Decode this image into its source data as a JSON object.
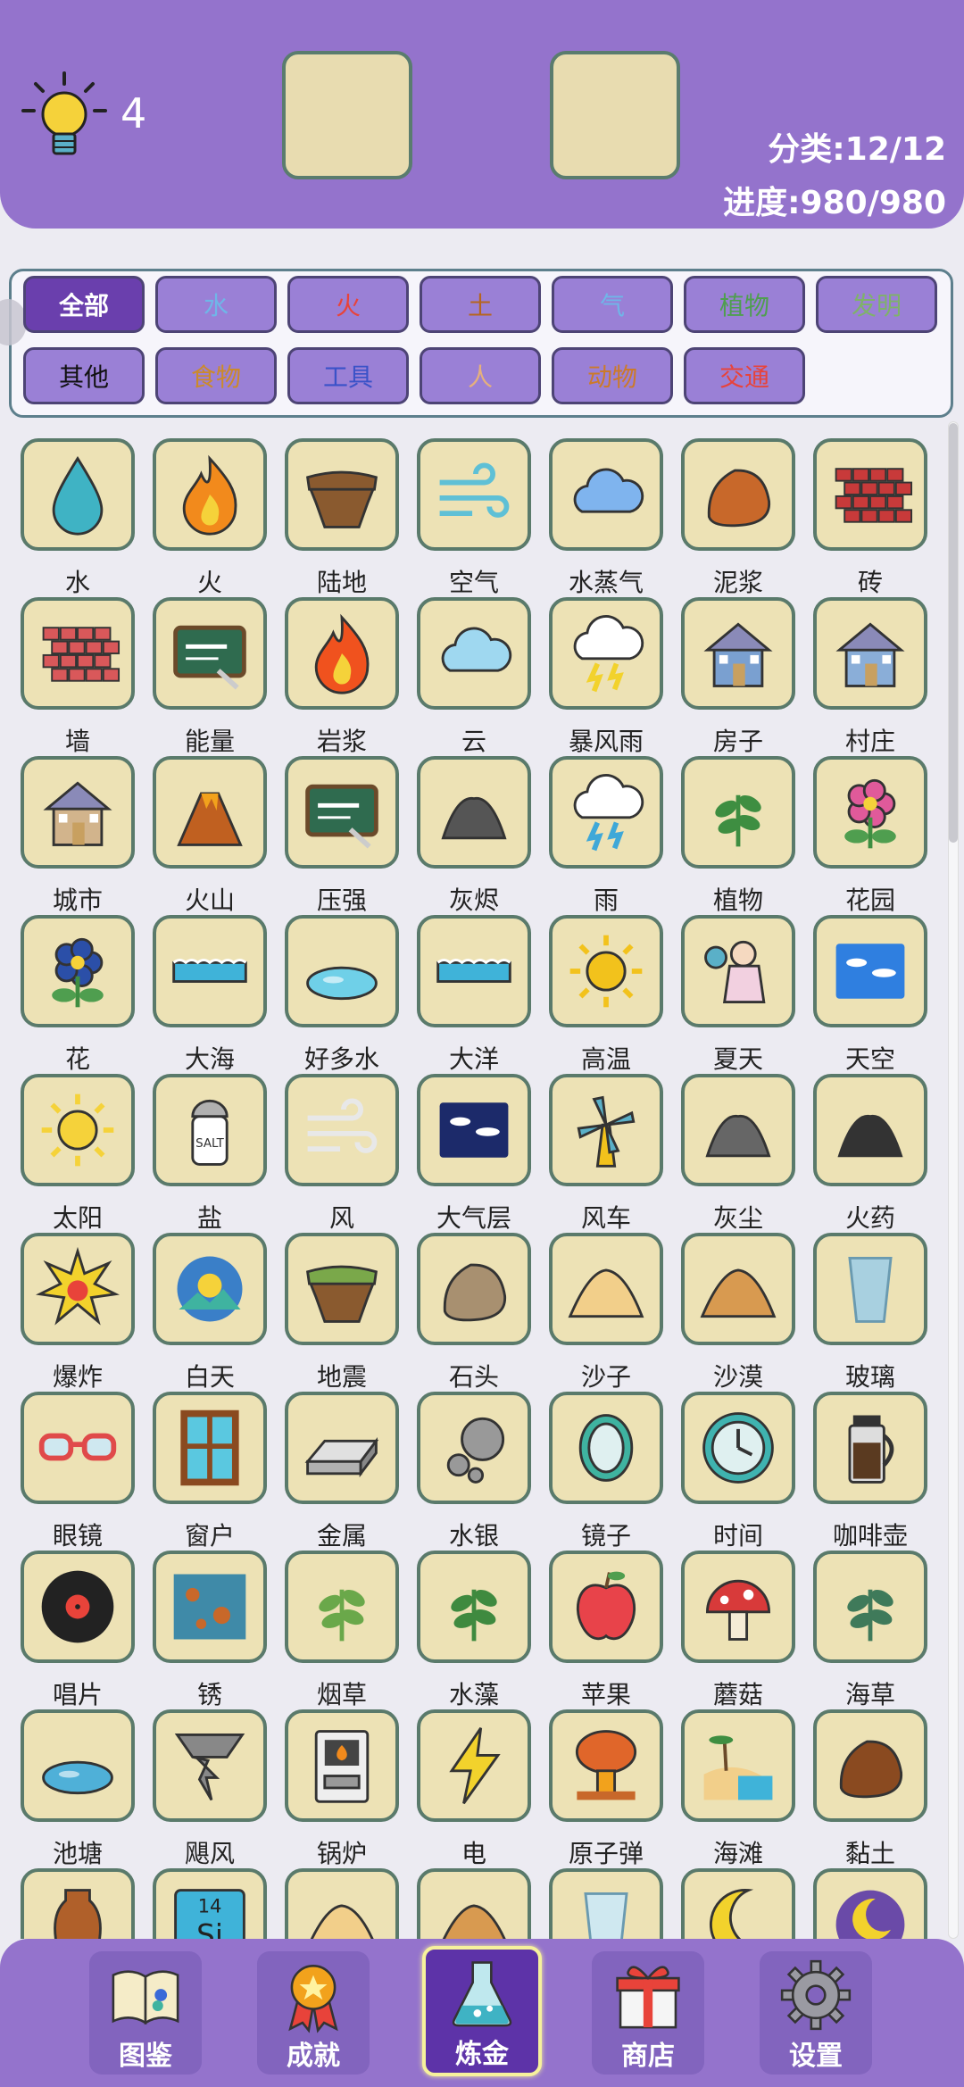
{
  "header": {
    "hint_count": "4",
    "category_stat": "分类:12/12",
    "progress_stat": "进度:980/980"
  },
  "filters": [
    {
      "label": "全部",
      "color": "#ffffff",
      "active": true
    },
    {
      "label": "水",
      "color": "#6fb6e8"
    },
    {
      "label": "火",
      "color": "#e8433a"
    },
    {
      "label": "土",
      "color": "#b6651f"
    },
    {
      "label": "气",
      "color": "#6fb6e8"
    },
    {
      "label": "植物",
      "color": "#4f9e4f"
    },
    {
      "label": "发明",
      "color": "#7fb26a"
    },
    {
      "label": "其他",
      "color": "#111111"
    },
    {
      "label": "食物",
      "color": "#cc8a2a"
    },
    {
      "label": "工具",
      "color": "#3a52c8"
    },
    {
      "label": "人",
      "color": "#e6b07c"
    },
    {
      "label": "动物",
      "color": "#cc7a2a"
    },
    {
      "label": "交通",
      "color": "#e8433a"
    }
  ],
  "elements": [
    {
      "label": "水",
      "icon": "water-drop-icon",
      "color": "#3fb3c4"
    },
    {
      "label": "火",
      "icon": "fire-icon",
      "color": "#f28a1c"
    },
    {
      "label": "陆地",
      "icon": "land-icon",
      "color": "#8a5a2f"
    },
    {
      "label": "空气",
      "icon": "air-icon",
      "color": "#5ec0d6"
    },
    {
      "label": "水蒸气",
      "icon": "steam-icon",
      "color": "#7fb4ee"
    },
    {
      "label": "泥浆",
      "icon": "mud-icon",
      "color": "#c8682a"
    },
    {
      "label": "砖",
      "icon": "brick-icon",
      "color": "#c83a3a"
    },
    {
      "label": "墙",
      "icon": "wall-icon",
      "color": "#d9585a"
    },
    {
      "label": "能量",
      "icon": "energy-board-icon",
      "color": "#2f6b4f"
    },
    {
      "label": "岩浆",
      "icon": "magma-icon",
      "color": "#f0521e"
    },
    {
      "label": "云",
      "icon": "cloud-icon",
      "color": "#9fd8f0"
    },
    {
      "label": "暴风雨",
      "icon": "storm-icon",
      "color": "#f2d22c"
    },
    {
      "label": "房子",
      "icon": "house-icon",
      "color": "#7aa0d0"
    },
    {
      "label": "村庄",
      "icon": "village-icon",
      "color": "#8aaed8"
    },
    {
      "label": "城市",
      "icon": "city-icon",
      "color": "#d2b48c"
    },
    {
      "label": "火山",
      "icon": "volcano-icon",
      "color": "#c06020"
    },
    {
      "label": "压强",
      "icon": "pressure-board-icon",
      "color": "#2f6b4f"
    },
    {
      "label": "灰烬",
      "icon": "ash-icon",
      "color": "#555555"
    },
    {
      "label": "雨",
      "icon": "rain-icon",
      "color": "#3fa8d8"
    },
    {
      "label": "植物",
      "icon": "plant-icon",
      "color": "#3e8e41"
    },
    {
      "label": "花园",
      "icon": "garden-icon",
      "color": "#e05a9a"
    },
    {
      "label": "花",
      "icon": "flower-icon",
      "color": "#2b4fa8"
    },
    {
      "label": "大海",
      "icon": "sea-icon",
      "color": "#3fb3d9"
    },
    {
      "label": "好多水",
      "icon": "puddle-icon",
      "color": "#6fd0e8"
    },
    {
      "label": "大洋",
      "icon": "ocean-icon",
      "color": "#3fb3d9"
    },
    {
      "label": "高温",
      "icon": "heat-icon",
      "color": "#f2c21c"
    },
    {
      "label": "夏天",
      "icon": "summer-icon",
      "color": "#e0a080"
    },
    {
      "label": "天空",
      "icon": "sky-icon",
      "color": "#2f7fe0"
    },
    {
      "label": "太阳",
      "icon": "sun-icon",
      "color": "#f5d23a"
    },
    {
      "label": "盐",
      "icon": "salt-icon",
      "color": "#b0b0b0"
    },
    {
      "label": "风",
      "icon": "wind-icon",
      "color": "#e8e8e8"
    },
    {
      "label": "大气层",
      "icon": "atmosphere-icon",
      "color": "#1c2a6a"
    },
    {
      "label": "风车",
      "icon": "windmill-icon",
      "color": "#f2c21c"
    },
    {
      "label": "灰尘",
      "icon": "dust-icon",
      "color": "#666666"
    },
    {
      "label": "火药",
      "icon": "gunpowder-icon",
      "color": "#333333"
    },
    {
      "label": "爆炸",
      "icon": "explosion-icon",
      "color": "#f2d22c"
    },
    {
      "label": "白天",
      "icon": "daytime-icon",
      "color": "#3a7fc8"
    },
    {
      "label": "地震",
      "icon": "earthquake-icon",
      "color": "#7aa84a"
    },
    {
      "label": "石头",
      "icon": "stone-icon",
      "color": "#a89070"
    },
    {
      "label": "沙子",
      "icon": "sand-icon",
      "color": "#f2cf8a"
    },
    {
      "label": "沙漠",
      "icon": "desert-icon",
      "color": "#d89a50"
    },
    {
      "label": "玻璃",
      "icon": "glass-icon",
      "color": "#a8d0e0"
    },
    {
      "label": "眼镜",
      "icon": "glasses-icon",
      "color": "#e04a4a"
    },
    {
      "label": "窗户",
      "icon": "window-icon",
      "color": "#8a4a20"
    },
    {
      "label": "金属",
      "icon": "metal-icon",
      "color": "#b0b0b0"
    },
    {
      "label": "水银",
      "icon": "mercury-icon",
      "color": "#999999"
    },
    {
      "label": "镜子",
      "icon": "mirror-icon",
      "color": "#3fb3a0"
    },
    {
      "label": "时间",
      "icon": "clock-icon",
      "color": "#3fb3b0"
    },
    {
      "label": "咖啡壶",
      "icon": "coffee-pot-icon",
      "color": "#5a3a20"
    },
    {
      "label": "唱片",
      "icon": "record-icon",
      "color": "#222222"
    },
    {
      "label": "锈",
      "icon": "rust-icon",
      "color": "#3f8aa8"
    },
    {
      "label": "烟草",
      "icon": "tobacco-icon",
      "color": "#6aa84a"
    },
    {
      "label": "水藻",
      "icon": "algae-icon",
      "color": "#3f8a3f"
    },
    {
      "label": "苹果",
      "icon": "apple-icon",
      "color": "#e8434a"
    },
    {
      "label": "蘑菇",
      "icon": "mushroom-icon",
      "color": "#d83a3a"
    },
    {
      "label": "海草",
      "icon": "seaweed-icon",
      "color": "#3f7a5a"
    },
    {
      "label": "池塘",
      "icon": "pond-icon",
      "color": "#4fb0d8"
    },
    {
      "label": "飓风",
      "icon": "tornado-icon",
      "color": "#888888"
    },
    {
      "label": "锅炉",
      "icon": "boiler-icon",
      "color": "#999999"
    },
    {
      "label": "电",
      "icon": "lightning-icon",
      "color": "#f2d22c"
    },
    {
      "label": "原子弹",
      "icon": "nuke-icon",
      "color": "#e0662a"
    },
    {
      "label": "海滩",
      "icon": "beach-icon",
      "color": "#3fb3d9"
    },
    {
      "label": "黏土",
      "icon": "clay-icon",
      "color": "#8a4a20"
    },
    {
      "label": "",
      "icon": "vase-icon",
      "color": "#b0602a"
    },
    {
      "label": "",
      "icon": "silicon-icon",
      "color": "#3fb3d9"
    },
    {
      "label": "",
      "icon": "sand-pile-icon",
      "color": "#f2cf8a"
    },
    {
      "label": "",
      "icon": "pyramid-icon",
      "color": "#d89a50"
    },
    {
      "label": "",
      "icon": "glass-cup-icon",
      "color": "#cfe8f0"
    },
    {
      "label": "",
      "icon": "moon-icon",
      "color": "#f2d22c"
    },
    {
      "label": "",
      "icon": "night-icon",
      "color": "#6a4aa8"
    }
  ],
  "nav": [
    {
      "label": "图鉴",
      "icon": "book-icon"
    },
    {
      "label": "成就",
      "icon": "medal-icon"
    },
    {
      "label": "炼金",
      "icon": "flask-icon",
      "active": true
    },
    {
      "label": "商店",
      "icon": "gift-icon"
    },
    {
      "label": "设置",
      "icon": "gear-icon"
    }
  ]
}
